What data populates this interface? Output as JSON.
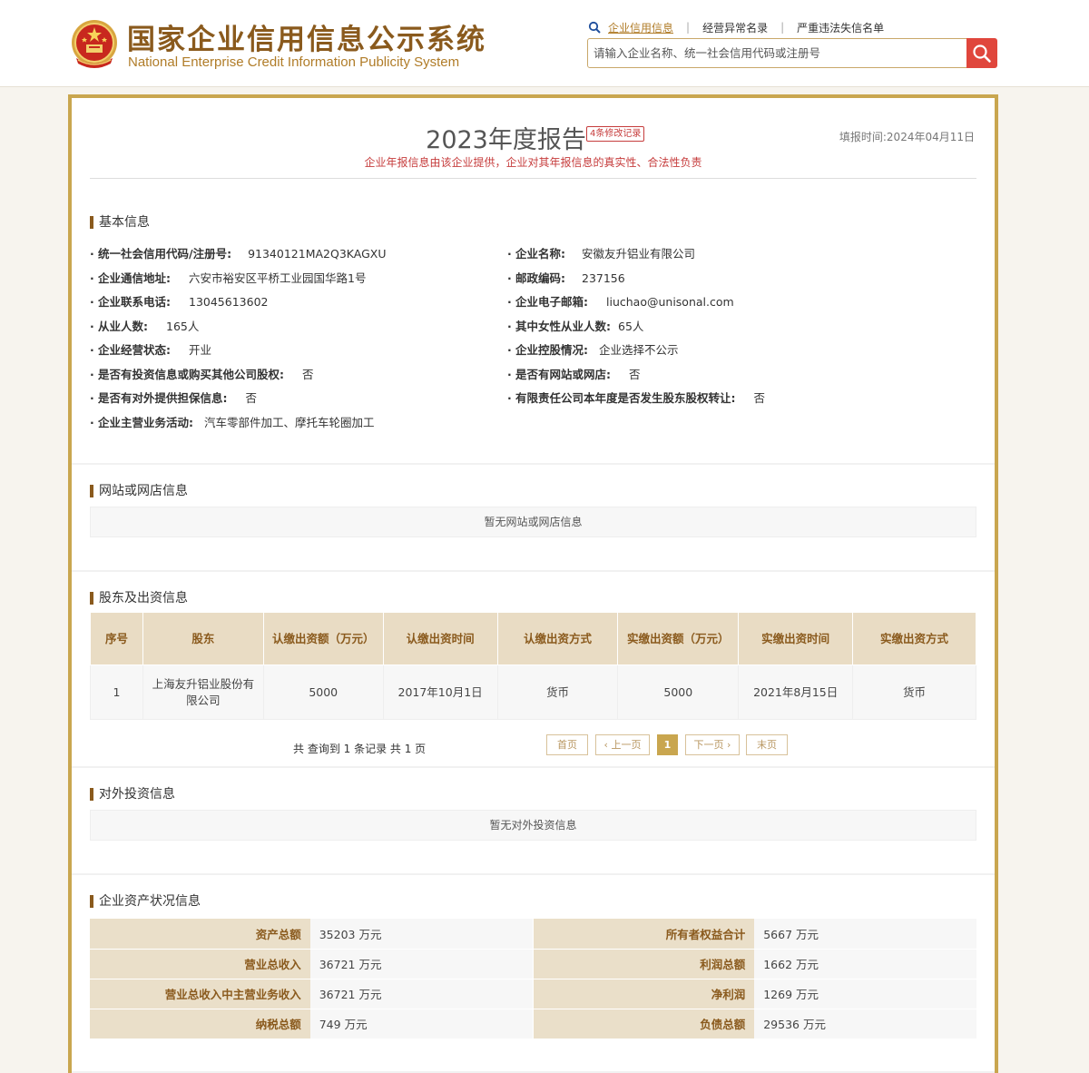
{
  "header": {
    "title_cn": "国家企业信用信息公示系统",
    "title_en": "National Enterprise Credit Information Publicity System",
    "nav": [
      "企业信用信息",
      "经营异常名录",
      "严重违法失信名单"
    ],
    "search_placeholder": "请输入企业名称、统一社会信用代码或注册号",
    "accent_color": "#c9a64f",
    "search_button_color": "#e0463c"
  },
  "report": {
    "title": "2023年度报告",
    "modification_badge": "4条修改记录",
    "fill_time": "填报时间:2024年04月11日",
    "disclaimer": "企业年报信息由该企业提供，企业对其年报信息的真实性、合法性负责"
  },
  "basic": {
    "section_title": "基本信息",
    "credit_code_label": "统一社会信用代码/注册号:",
    "credit_code": "91340121MA2Q3KAGXU",
    "name_label": "企业名称:",
    "name": "安徽友升铝业有限公司",
    "address_label": "企业通信地址:",
    "address": "六安市裕安区平桥工业园国华路1号",
    "postcode_label": "邮政编码:",
    "postcode": "237156",
    "phone_label": "企业联系电话:",
    "phone": "13045613602",
    "email_label": "企业电子邮箱:",
    "email": "liuchao@unisonal.com",
    "employees_label": "从业人数:",
    "employees": "165人",
    "female_label": "其中女性从业人数:",
    "female": "65人",
    "status_label": "企业经营状态:",
    "status": "开业",
    "holding_label": "企业控股情况:",
    "holding": "企业选择不公示",
    "invest_label": "是否有投资信息或购买其他公司股权:",
    "invest": "否",
    "website_label": "是否有网站或网店:",
    "website": "否",
    "guarantee_label": "是否有对外提供担保信息:",
    "guarantee": "否",
    "transfer_label": "有限责任公司本年度是否发生股东股权转让:",
    "transfer": "否",
    "business_label": "企业主营业务活动:",
    "business": "汽车零部件加工、摩托车轮圈加工"
  },
  "website_section": {
    "title": "网站或网店信息",
    "empty": "暂无网站或网店信息"
  },
  "shareholders": {
    "title": "股东及出资信息",
    "headers": [
      "序号",
      "股东",
      "认缴出资额（万元）",
      "认缴出资时间",
      "认缴出资方式",
      "实缴出资额（万元）",
      "实缴出资时间",
      "实缴出资方式"
    ],
    "rows": [
      [
        "1",
        "上海友升铝业股份有限公司",
        "5000",
        "2017年10月1日",
        "货币",
        "5000",
        "2021年8月15日",
        "货币"
      ]
    ],
    "pager_info": "共 查询到 1 条记录 共 1 页",
    "pager": {
      "first": "首页",
      "prev": "上一页",
      "current": "1",
      "next": "下一页",
      "last": "末页"
    }
  },
  "investment": {
    "title": "对外投资信息",
    "empty": "暂无对外投资信息"
  },
  "assets": {
    "title": "企业资产状况信息",
    "rows": [
      {
        "k1": "资产总额",
        "v1": "35203 万元",
        "k2": "所有者权益合计",
        "v2": "5667 万元"
      },
      {
        "k1": "营业总收入",
        "v1": "36721 万元",
        "k2": "利润总额",
        "v2": "1662 万元"
      },
      {
        "k1": "营业总收入中主营业务收入",
        "v1": "36721 万元",
        "k2": "净利润",
        "v2": "1269 万元"
      },
      {
        "k1": "纳税总额",
        "v1": "749 万元",
        "k2": "负债总额",
        "v2": "29536 万元"
      }
    ]
  }
}
